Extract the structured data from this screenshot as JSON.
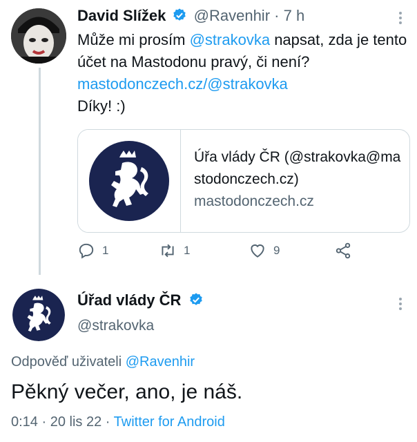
{
  "tweet1": {
    "author_name": "David Slížek",
    "handle": "@Ravenhir",
    "separator": "·",
    "time": "7 h",
    "text_part1": "Může mi prosím ",
    "mention": "@strakovka",
    "text_part2": " napsat, zda je tento účet na Mastodonu pravý, či není? ",
    "link": "mastodonczech.cz/@strakovka",
    "text_part3": "Díky! :)",
    "card": {
      "title": "Úřa vlády ČR (@strakovka@mastodonczech.cz)",
      "domain": "mastodonczech.cz"
    },
    "actions": {
      "reply_count": "1",
      "retweet_count": "1",
      "like_count": "9"
    }
  },
  "tweet2": {
    "author_name": "Úřad vlády ČR",
    "handle": "@strakovka",
    "reply_prefix": "Odpověď uživateli ",
    "reply_to": "@Ravenhir",
    "text": "Pěkný večer, ano, je náš.",
    "time": "0:14",
    "dot1": "·",
    "date": "20 lis 22",
    "dot2": "·",
    "source": "Twitter for Android"
  },
  "colors": {
    "accent": "#1d9bf0",
    "muted": "#536471",
    "emblem_bg": "#1a2450"
  }
}
